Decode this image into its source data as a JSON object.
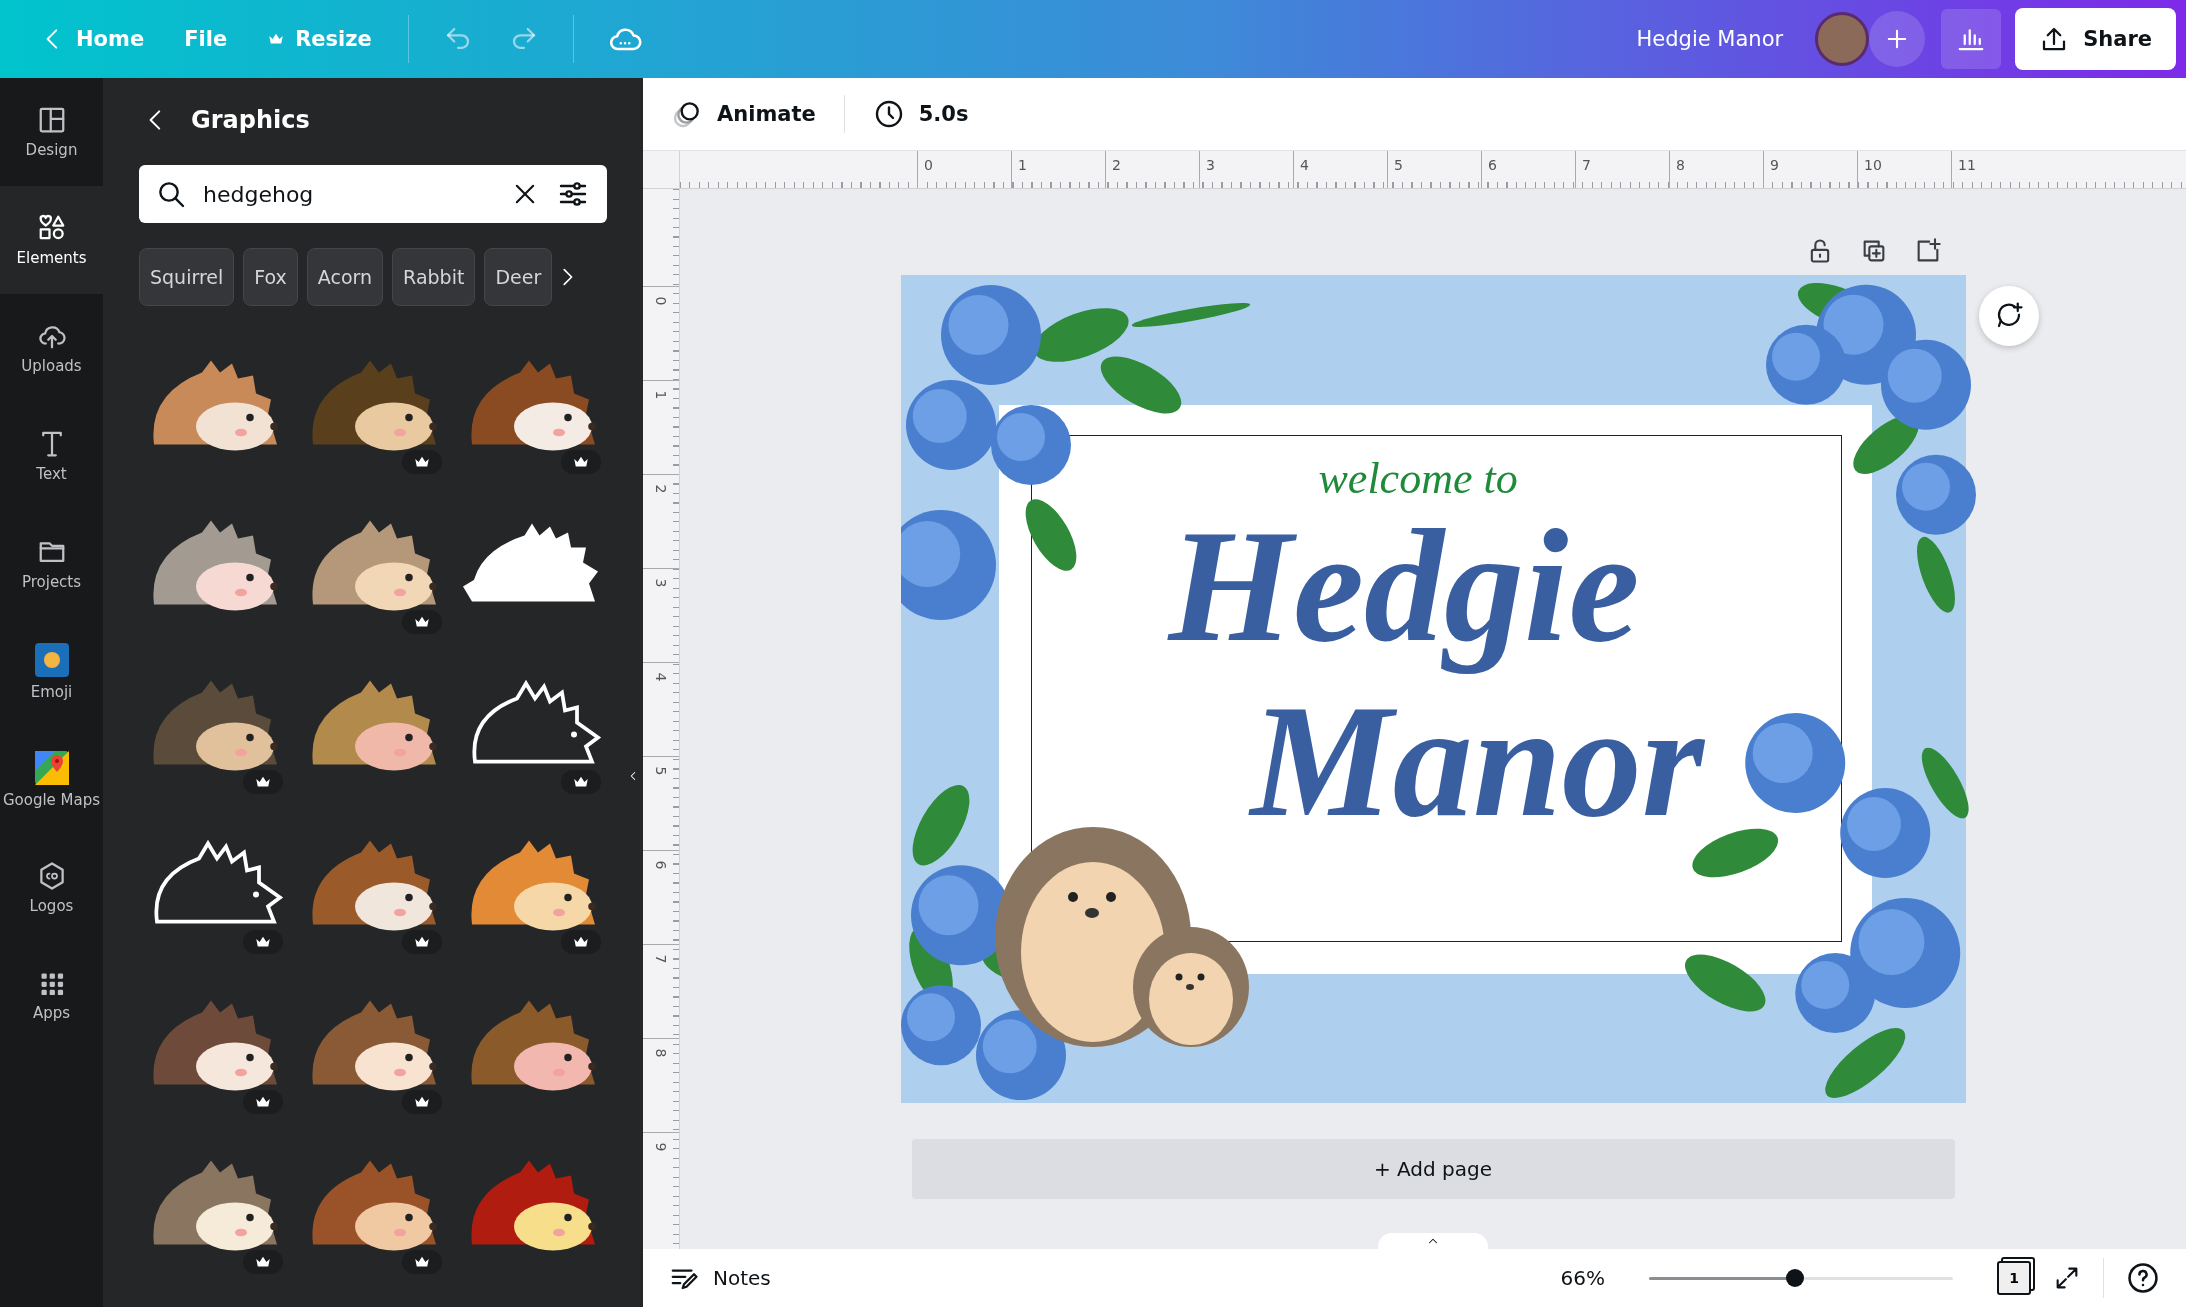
{
  "topbar": {
    "home": "Home",
    "file": "File",
    "resize": "Resize",
    "title": "Hedgie Manor",
    "share": "Share"
  },
  "rail": [
    {
      "kind": "design",
      "label": "Design",
      "selected": false
    },
    {
      "kind": "elements",
      "label": "Elements",
      "selected": true
    },
    {
      "kind": "uploads",
      "label": "Uploads",
      "selected": false
    },
    {
      "kind": "text",
      "label": "Text",
      "selected": false
    },
    {
      "kind": "projects",
      "label": "Projects",
      "selected": false
    },
    {
      "kind": "emoji",
      "label": "Emoji",
      "selected": false
    },
    {
      "kind": "maps",
      "label": "Google Maps",
      "selected": false
    },
    {
      "kind": "logos",
      "label": "Logos",
      "selected": false
    },
    {
      "kind": "apps",
      "label": "Apps",
      "selected": false
    }
  ],
  "panel": {
    "title": "Graphics",
    "search": {
      "value": "hedgehog"
    },
    "chips": [
      "Squirrel",
      "Fox",
      "Acorn",
      "Rabbit",
      "Deer"
    ],
    "graphics": [
      {
        "kind": "color",
        "premium": false
      },
      {
        "kind": "color",
        "premium": true
      },
      {
        "kind": "color",
        "premium": true
      },
      {
        "kind": "color",
        "premium": false
      },
      {
        "kind": "color",
        "premium": true
      },
      {
        "kind": "silhouette",
        "premium": false
      },
      {
        "kind": "color",
        "premium": true
      },
      {
        "kind": "color",
        "premium": false
      },
      {
        "kind": "outline",
        "premium": true
      },
      {
        "kind": "outline",
        "premium": true
      },
      {
        "kind": "color",
        "premium": true
      },
      {
        "kind": "color",
        "premium": true
      },
      {
        "kind": "color",
        "premium": true
      },
      {
        "kind": "color",
        "premium": true
      },
      {
        "kind": "color",
        "premium": false
      },
      {
        "kind": "color",
        "premium": true
      },
      {
        "kind": "color",
        "premium": true
      },
      {
        "kind": "color",
        "premium": false
      }
    ]
  },
  "toolbar": {
    "animate": "Animate",
    "duration": "5.0s"
  },
  "rulers": {
    "horizontal": [
      "0",
      "1",
      "2",
      "3",
      "4",
      "5",
      "6",
      "7",
      "8",
      "9",
      "10",
      "11"
    ],
    "vertical": [
      "0",
      "1",
      "2",
      "3",
      "4",
      "5",
      "6",
      "7",
      "8",
      "9"
    ]
  },
  "design": {
    "subtitle": "welcome to",
    "title_line_1": "Hedgie",
    "title_line_2": "Manor"
  },
  "add_page": "+ Add page",
  "bottom_bar": {
    "notes": "Notes",
    "zoom": "66%",
    "zoom_slider": {
      "level": 0.48
    },
    "page_count": "1"
  }
}
